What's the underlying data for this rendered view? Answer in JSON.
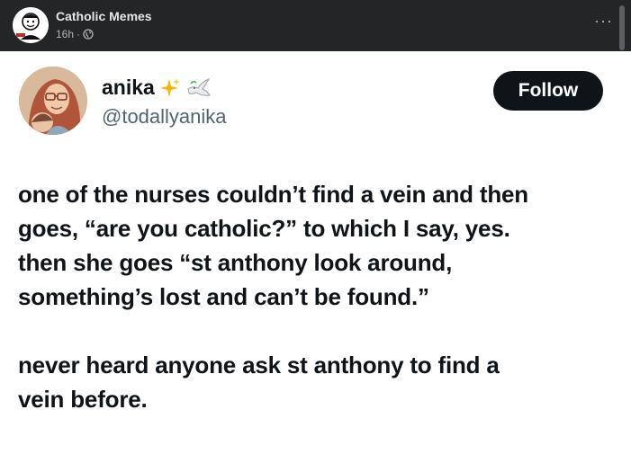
{
  "fb_post": {
    "page_name": "Catholic Memes",
    "time": "16h",
    "separator": "·",
    "more_label": "···"
  },
  "tweet": {
    "display_name": "anika",
    "handle": "@todallyanika",
    "follow_label": "Follow",
    "emoji_sparkles": "✨",
    "emoji_dove": "🕊",
    "lines_paragraph_1": [
      "one of the nurses couldn’t find a vein and then",
      "goes, “are you catholic?” to which I say, yes.",
      "then she goes “st anthony look around,",
      "something’s lost and can’t be found.”"
    ],
    "lines_paragraph_2": [
      "never heard anyone ask st anthony to find a",
      "vein before."
    ]
  },
  "colors": {
    "fb_background": "#242526",
    "card_background": "#ffffff",
    "follow_button": "#0f1419",
    "handle_gray": "#536471",
    "sparkle_gold": "#f4b400"
  }
}
